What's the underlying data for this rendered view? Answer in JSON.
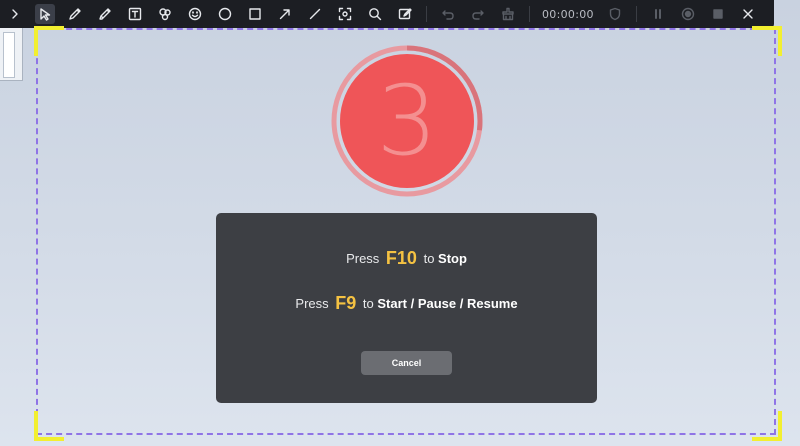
{
  "toolbar": {
    "tools": [
      {
        "name": "expand-icon"
      },
      {
        "name": "select-pointer-icon",
        "active": true
      },
      {
        "name": "pen-icon"
      },
      {
        "name": "highlighter-icon"
      },
      {
        "name": "text-tool-icon"
      },
      {
        "name": "shapes-icon"
      },
      {
        "name": "emoji-icon"
      },
      {
        "name": "ellipse-icon"
      },
      {
        "name": "rectangle-icon"
      },
      {
        "name": "arrow-icon"
      },
      {
        "name": "line-icon"
      },
      {
        "name": "focus-area-icon"
      },
      {
        "name": "magnifier-icon"
      },
      {
        "name": "whiteboard-icon"
      },
      {
        "name": "undo-icon"
      },
      {
        "name": "redo-icon"
      },
      {
        "name": "clear-icon"
      }
    ],
    "timer": "00:00:00",
    "controls": [
      {
        "name": "shield-icon"
      },
      {
        "name": "pause-icon"
      },
      {
        "name": "record-icon"
      },
      {
        "name": "stop-icon"
      },
      {
        "name": "close-icon"
      }
    ],
    "accent_color": "#1c1e23"
  },
  "countdown": {
    "value": "3",
    "progress": 0.27,
    "fill_color": "#ef5558",
    "ring_color": "#e89aa0"
  },
  "dialog": {
    "line1": {
      "prefix": "Press",
      "key": "F10",
      "middle": "to",
      "action": "Stop"
    },
    "line2": {
      "prefix": "Press",
      "key": "F9",
      "middle": "to",
      "action": "Start / Pause / Resume"
    },
    "cancel_label": "Cancel",
    "key_color": "#f5c242"
  },
  "frame": {
    "border_color": "#8f74e6",
    "corner_color": "#f2ef30"
  }
}
